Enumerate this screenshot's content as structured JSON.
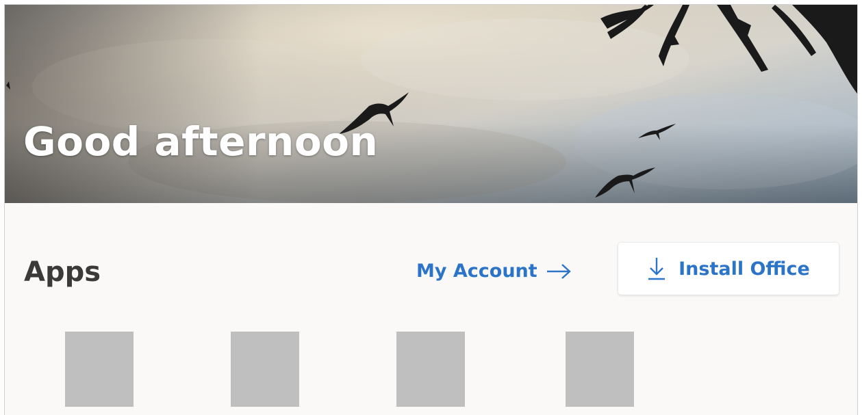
{
  "header": {
    "greeting": "Good afternoon"
  },
  "apps_section": {
    "title": "Apps",
    "my_account_label": "My Account",
    "install_label": "Install Office",
    "tiles": [
      "app-tile-1",
      "app-tile-2",
      "app-tile-3",
      "app-tile-4"
    ]
  },
  "icons": {
    "my_account": "arrow-right-icon",
    "install": "download-icon"
  },
  "colors": {
    "accent": "#2b74c8",
    "heading": "#3b3a39",
    "background": "#faf9f8",
    "tile": "#bfbfbf"
  }
}
